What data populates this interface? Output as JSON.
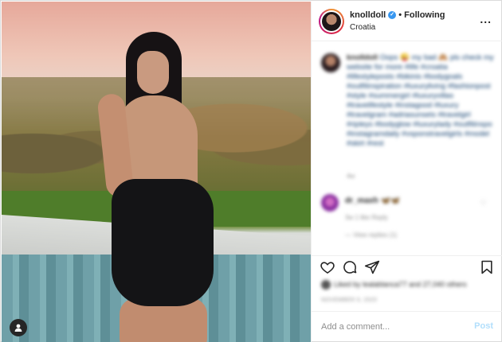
{
  "header": {
    "username": "knolldoll",
    "verified_icon": "verified-badge-icon",
    "follow_label": "• Following",
    "location": "Croatia",
    "more_label": "..."
  },
  "caption": {
    "username": "knolldoll",
    "text": "Oops 😜 my bad 🙈 pls check my website for more #life #croatia #lifestyleposts #bikinis #bodygoals #outfitinspiration #luxuryliving #fashionpost #style #summergirl #luxuryvillas #travelifestyle #instagood #luxury #travelgram #adriasunsets #travelgirl #ripleys #bodyglow #luxurylady #outfitinspo #instagramdaily #vsponstravelgirls #model #skirt #rest",
    "time": "4w"
  },
  "comment2": {
    "username": "dr_maxh",
    "text": "🦋🦋",
    "meta": "3w  1 like  Reply",
    "replies": "— View replies (1)"
  },
  "likes": {
    "text": "Liked by lealablanca77 and 27,040 others"
  },
  "date": "November 9, 2020",
  "comment_box": {
    "placeholder": "Add a comment...",
    "post_label": "Post"
  },
  "colors": {
    "accent": "#3897f0",
    "post_disabled": "#b2dffc",
    "hashtag": "#0a3a6b"
  }
}
